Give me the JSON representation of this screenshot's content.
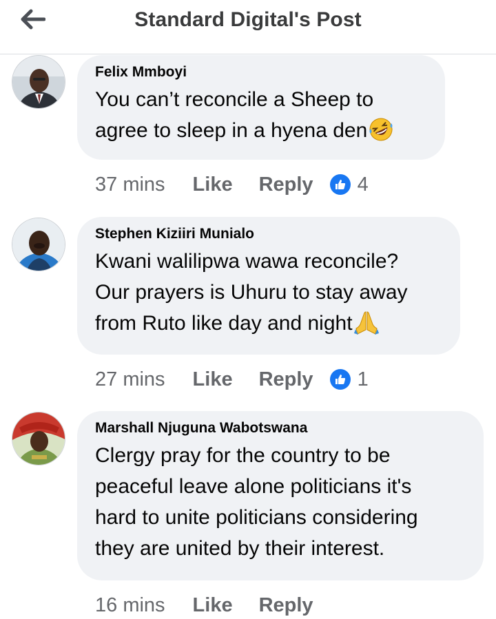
{
  "header": {
    "title": "Standard Digital's Post",
    "back_icon": "arrow-left-icon"
  },
  "comments": [
    {
      "author": "Felix Mmboyi",
      "lines": [
        "You can’t reconcile a Sheep to",
        "agree to sleep in a hyena den"
      ],
      "emoji": "rolling-on-floor-laughing-icon",
      "time": "37 mins",
      "like_label": "Like",
      "reply_label": "Reply",
      "reaction_count": "4"
    },
    {
      "author": "Stephen Kiziiri Munialo",
      "lines": [
        "Kwani walilipwa wawa reconcile?",
        "Our prayers is Uhuru to stay away",
        "from Ruto like day and night"
      ],
      "emoji": "folded-hands-icon",
      "time": "27 mins",
      "like_label": "Like",
      "reply_label": "Reply",
      "reaction_count": "1"
    },
    {
      "author": "Marshall Njuguna Wabotswana",
      "lines": [
        "Clergy pray for the country to be",
        "peaceful leave alone politicians it's",
        "hard to unite politicians considering",
        "they are united by their interest."
      ],
      "time": "16 mins",
      "like_label": "Like",
      "reply_label": "Reply"
    }
  ],
  "colors": {
    "accent": "#1877f2",
    "bubble": "#f0f2f5",
    "meta_text": "#65676b"
  }
}
